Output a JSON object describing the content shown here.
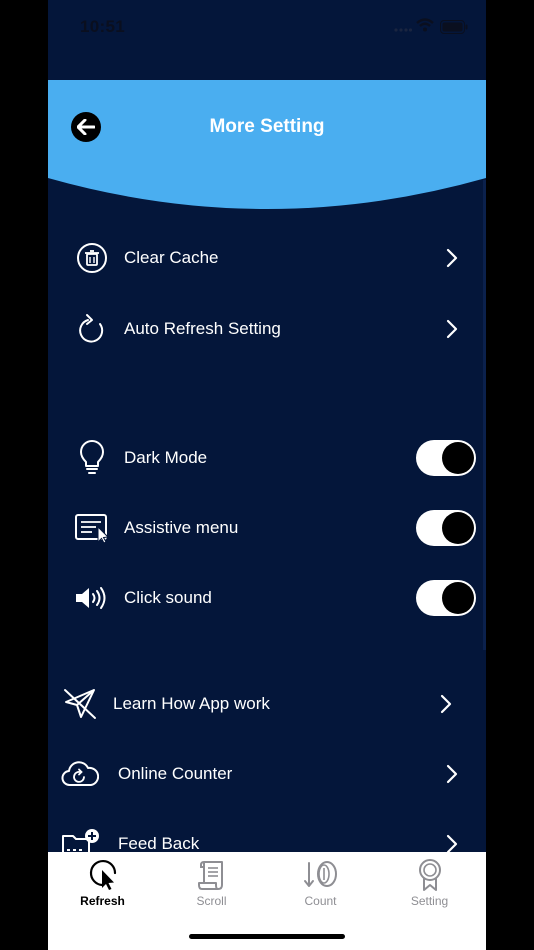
{
  "status_bar": {
    "time": "10:51"
  },
  "header": {
    "title": "More Setting",
    "color": "#4aaef0"
  },
  "rows": [
    {
      "label": "Clear Cache",
      "icon": "trash-icon",
      "type": "link"
    },
    {
      "label": "Auto Refresh Setting",
      "icon": "refresh-icon",
      "type": "link"
    },
    {
      "label": "Dark Mode",
      "icon": "lightbulb-icon",
      "type": "toggle",
      "on": true
    },
    {
      "label": "Assistive menu",
      "icon": "assistive-menu-icon",
      "type": "toggle",
      "on": true
    },
    {
      "label": "Click sound",
      "icon": "speaker-icon",
      "type": "toggle",
      "on": true
    },
    {
      "label": "Learn How App work",
      "icon": "paper-plane-icon",
      "type": "link"
    },
    {
      "label": "Online Counter",
      "icon": "cloud-refresh-icon",
      "type": "link"
    },
    {
      "label": "Feed Back",
      "icon": "folder-add-icon",
      "type": "link"
    }
  ],
  "tabs": [
    {
      "label": "Refresh",
      "icon": "cursor-click-icon",
      "active": true
    },
    {
      "label": "Scroll",
      "icon": "scroll-icon",
      "active": false
    },
    {
      "label": "Count",
      "icon": "count-icon",
      "active": false
    },
    {
      "label": "Setting",
      "icon": "award-icon",
      "active": false
    }
  ],
  "colors": {
    "background": "#04163a",
    "accent": "#4aaef0",
    "tab_active": "#000000",
    "tab_inactive": "#8e8e93"
  }
}
